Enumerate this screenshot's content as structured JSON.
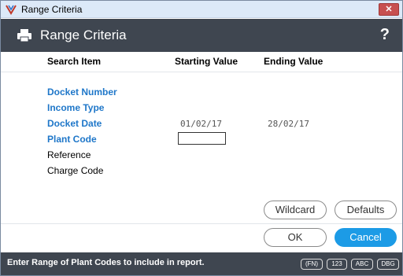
{
  "window": {
    "title": "Range Criteria",
    "close_symbol": "✕"
  },
  "header": {
    "title": "Range Criteria",
    "help_symbol": "?"
  },
  "columns": {
    "search_item": "Search Item",
    "starting_value": "Starting Value",
    "ending_value": "Ending Value"
  },
  "rows": [
    {
      "label": "Docket Number",
      "start": "",
      "end": ""
    },
    {
      "label": "Income Type",
      "start": "",
      "end": ""
    },
    {
      "label": "Docket Date",
      "start": "01/02/17",
      "end": "28/02/17"
    },
    {
      "label": "Plant Code",
      "start": "",
      "end": ""
    },
    {
      "label": "Reference",
      "start": "",
      "end": ""
    },
    {
      "label": "Charge Code",
      "start": "",
      "end": ""
    }
  ],
  "buttons": {
    "wildcard": "Wildcard",
    "defaults": "Defaults",
    "ok": "OK",
    "cancel": "Cancel"
  },
  "status": {
    "message": "Enter Range of Plant Codes to include in report.",
    "indicators": [
      "(FN)",
      "123",
      "ABC",
      "DBG"
    ]
  },
  "colors": {
    "link": "#1f77c9",
    "header_bg": "#3f4650",
    "primary_button": "#1c9be6"
  }
}
